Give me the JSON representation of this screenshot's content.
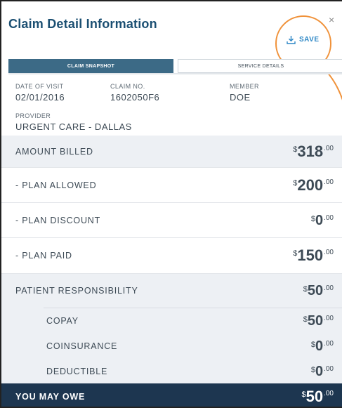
{
  "panel": {
    "title": "Claim Detail Information",
    "close_label": "×",
    "save_label": "SAVE"
  },
  "tabs": [
    {
      "label": "CLAIM SNAPSHOT",
      "active": true
    },
    {
      "label": "SERVICE DETAILS",
      "active": false
    }
  ],
  "claim": {
    "date_of_visit_label": "DATE OF VISIT",
    "date_of_visit": "02/01/2016",
    "claim_no_label": "CLAIM NO.",
    "claim_no": "1602050F6",
    "member_label": "MEMBER",
    "member": "DOE",
    "provider_label": "PROVIDER",
    "provider": "URGENT CARE - DALLAS"
  },
  "rows": {
    "amount_billed": {
      "label": "AMOUNT BILLED",
      "currency": "$",
      "whole": "318",
      "cents": ".00"
    },
    "plan_allowed": {
      "label": "- PLAN ALLOWED",
      "currency": "$",
      "whole": "200",
      "cents": ".00"
    },
    "plan_discount": {
      "label": "- PLAN DISCOUNT",
      "currency": "$",
      "whole": "0",
      "cents": ".00"
    },
    "plan_paid": {
      "label": "- PLAN PAID",
      "currency": "$",
      "whole": "150",
      "cents": ".00"
    },
    "patient_responsibility": {
      "label": "PATIENT RESPONSIBILITY",
      "currency": "$",
      "whole": "50",
      "cents": ".00"
    },
    "copay": {
      "label": "COPAY",
      "currency": "$",
      "whole": "50",
      "cents": ".00"
    },
    "coinsurance": {
      "label": "COINSURANCE",
      "currency": "$",
      "whole": "0",
      "cents": ".00"
    },
    "deductible": {
      "label": "DEDUCTIBLE",
      "currency": "$",
      "whole": "0",
      "cents": ".00"
    },
    "you_may_owe": {
      "label": "YOU MAY OWE",
      "currency": "$",
      "whole": "50",
      "cents": ".00"
    }
  },
  "colors": {
    "title": "#1b4f72",
    "save": "#2b86c5",
    "highlight_ring": "#f0923a",
    "active_tab": "#3c6a86",
    "grey_row": "#edf0f4",
    "owe_row": "#1d3650"
  },
  "icons": {
    "save": "download-tray-icon",
    "close": "close-icon"
  }
}
